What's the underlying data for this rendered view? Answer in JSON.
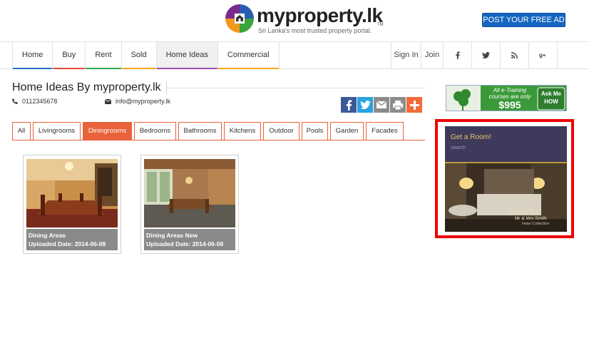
{
  "header": {
    "logo_text": "myproperty.lk",
    "logo_tm": "TM",
    "tagline": "Sri Lanka's most trusted property portal.",
    "post_ad_label": "POST YOUR FREE AD"
  },
  "nav": {
    "items": [
      {
        "label": "Home",
        "bar_color": "#2a6fc9"
      },
      {
        "label": "Buy",
        "bar_color": "#e94a3c"
      },
      {
        "label": "Rent",
        "bar_color": "#33a852"
      },
      {
        "label": "Sold",
        "bar_color": "#f2a81d"
      },
      {
        "label": "Home Ideas",
        "bar_color": "#9c4fb3",
        "active": true
      },
      {
        "label": "Commercial",
        "bar_color": "#f2a81d"
      }
    ],
    "right": {
      "sign_in": "Sign In",
      "join": "Join",
      "icons": [
        "facebook-icon",
        "twitter-icon",
        "rss-icon",
        "google-plus-icon"
      ]
    }
  },
  "page": {
    "title": "Home Ideas By myproperty.lk",
    "phone": "0112345678",
    "email": "info@myproperty.lk"
  },
  "share": {
    "icons": [
      "facebook-share-icon",
      "twitter-share-icon",
      "email-share-icon",
      "print-share-icon",
      "more-share-icon"
    ],
    "colors": [
      "#3b5998",
      "#2aa3df",
      "#8c8c8c",
      "#8c8c8c",
      "#f26b3a"
    ]
  },
  "tabs": [
    {
      "label": "All"
    },
    {
      "label": "Livingrooms"
    },
    {
      "label": "Diningrooms",
      "active": true
    },
    {
      "label": "Bedrooms"
    },
    {
      "label": "Bathrooms"
    },
    {
      "label": "Kitchens"
    },
    {
      "label": "Outdoor"
    },
    {
      "label": "Pools"
    },
    {
      "label": "Garden"
    },
    {
      "label": "Facades"
    }
  ],
  "gallery": [
    {
      "title": "Dining Areas",
      "uploaded": "Uploaded Date: 2014-06-08"
    },
    {
      "title": "Dining Areas New",
      "uploaded": "Uploaded Date: 2014-06-08"
    }
  ],
  "ads": {
    "top": {
      "line1": "All e-Training",
      "line2": "courses are only",
      "price": "$995",
      "cta_line1": "Ask Me",
      "cta_line2": "HOW"
    },
    "box": {
      "headline": "Get a Room!",
      "search": "search",
      "brand": "Mr & Mrs Smith",
      "brand_sub": "Hotel Collection",
      "script": "Smith"
    }
  },
  "colors": {
    "accent": "#e8623a",
    "post_ad": "#1565c0",
    "highlight_border": "#ee0000"
  }
}
